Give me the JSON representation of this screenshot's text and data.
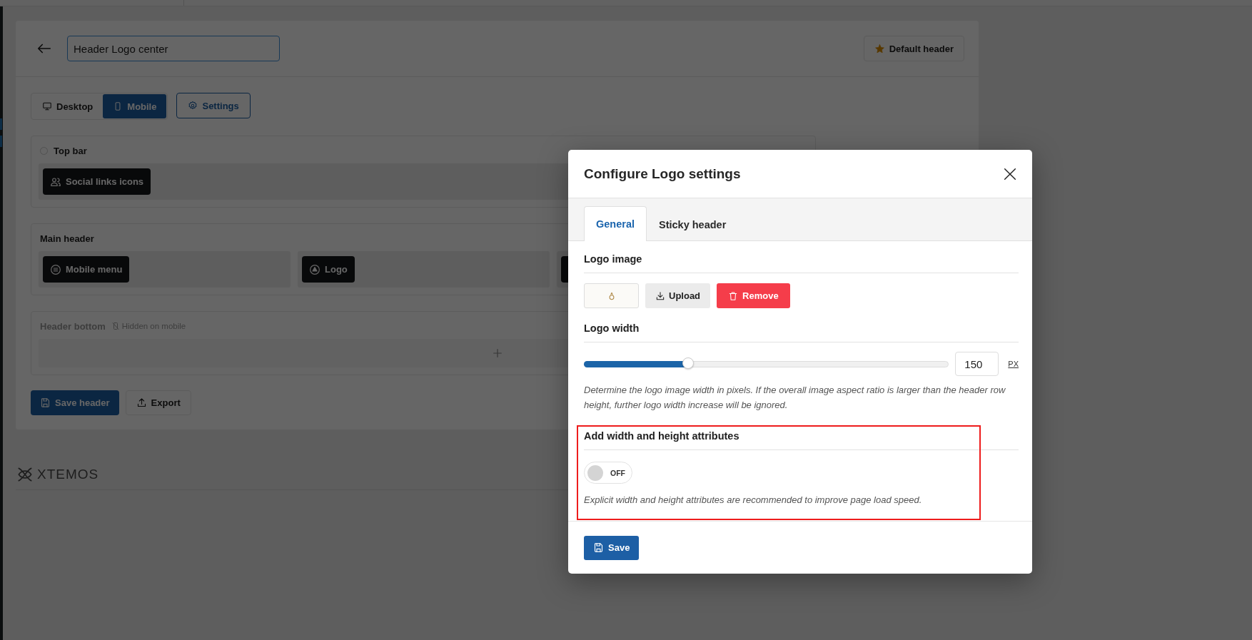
{
  "page": {
    "title_field": {
      "value": "Header Logo center"
    },
    "default_button": "Default header",
    "view_tabs": [
      {
        "label": "Desktop",
        "selected": false
      },
      {
        "label": "Mobile",
        "selected": true
      }
    ],
    "settings_button": "Settings",
    "sections": [
      {
        "kind": "top",
        "title": "Top bar",
        "checked": false,
        "columns": [
          {
            "elements": [
              {
                "kind": "chip",
                "label": "Social links icons"
              }
            ]
          }
        ]
      },
      {
        "kind": "main",
        "title": "Main header",
        "columns": [
          {
            "elements": [
              {
                "kind": "chip",
                "label": "Mobile menu"
              }
            ]
          },
          {
            "elements": [
              {
                "kind": "chip",
                "label": "Logo"
              }
            ]
          },
          {
            "elements": [
              {
                "kind": "chip"
              }
            ]
          }
        ]
      },
      {
        "kind": "bottom",
        "title": "Header bottom",
        "note": "Hidden on mobile"
      }
    ],
    "save_button": "Save header",
    "export_button": "Export",
    "footer_logo": "XTEMOS"
  },
  "modal": {
    "title": "Configure Logo settings",
    "tabs": [
      {
        "label": "General",
        "selected": true
      },
      {
        "label": "Sticky header",
        "selected": false
      }
    ],
    "logo_image": {
      "heading": "Logo image",
      "upload": "Upload",
      "remove": "Remove"
    },
    "logo_width": {
      "heading": "Logo width",
      "level": 0.284,
      "value": "150",
      "unit": "PX",
      "description": "Determine the logo image width in pixels. If the overall image aspect ratio is larger than the header row height, further logo width increase will be ignored."
    },
    "attributes": {
      "heading": "Add width and height attributes",
      "on": false,
      "state_label": "OFF",
      "description": "Explicit width and height attributes are recommended to improve page load speed."
    },
    "save": "Save"
  }
}
